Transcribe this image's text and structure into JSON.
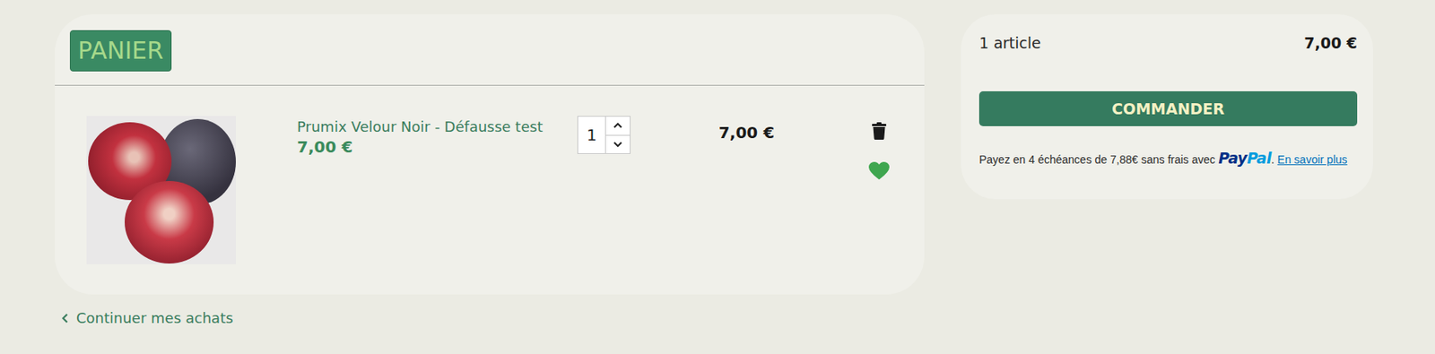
{
  "cart": {
    "title": "PANIER",
    "items": [
      {
        "name": "Prumix Velour Noir - Défausse test",
        "unit_price": "7,00 €",
        "quantity": "1",
        "total": "7,00 €",
        "favorite": true
      }
    ],
    "continue_link": "Continuer mes achats"
  },
  "summary": {
    "count": "1 article",
    "total": "7,00 €",
    "checkout_button": "COMMANDER",
    "paypal": {
      "text": "Payez en 4 échéances de 7,88€ sans frais avec",
      "logo": [
        "Pay",
        "Pal"
      ],
      "punctuation": ".",
      "link": "En savoir plus"
    }
  }
}
